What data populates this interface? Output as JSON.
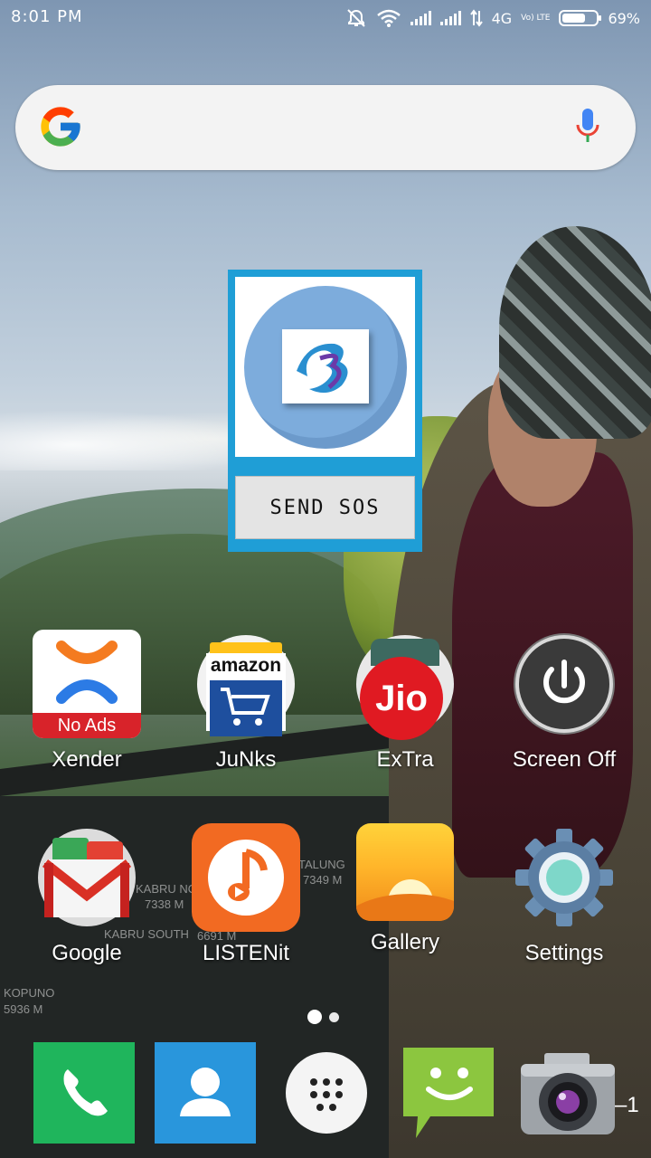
{
  "status_bar": {
    "time": "8:01 PM",
    "network_type": "4G",
    "volte_label": "Vo) LTE",
    "battery_percent_label": "69%",
    "battery_level": 0.69
  },
  "search": {
    "logo": "G",
    "mic_icon": "mic-icon"
  },
  "widget": {
    "logo_icon": "b-logo-icon",
    "sos_label": "SEND SOS"
  },
  "apps_row1": [
    {
      "label": "Xender",
      "badge": "No Ads",
      "icon": "xender-icon"
    },
    {
      "label": "JuNks",
      "icon_text": "amazon",
      "icon": "amazon-icon"
    },
    {
      "label": "ExTra",
      "icon_text": "Jio",
      "icon": "jio-icon"
    },
    {
      "label": "Screen Off",
      "icon": "power-icon"
    }
  ],
  "apps_row2": [
    {
      "label": "Google",
      "icon": "gmail-icon"
    },
    {
      "label": "LISTENit",
      "icon": "music-note-icon"
    },
    {
      "label": "Gallery",
      "icon": "gallery-icon"
    },
    {
      "label": "Settings",
      "icon": "gear-icon"
    }
  ],
  "wallpaper_labels": {
    "kabru_north": "KABRU NORTH",
    "kabru_north_height": "7338 M",
    "kabru_south": "KABRU SOUTH",
    "kabru_south_height": "6691 M",
    "talung": "TALUNG",
    "talung_height": "7349 M",
    "kopuno": "KOPUNO",
    "kopuno_height": "5936 M"
  },
  "dock": [
    {
      "icon": "phone-icon"
    },
    {
      "icon": "contacts-icon"
    },
    {
      "icon": "app-drawer-icon"
    },
    {
      "icon": "messaging-icon"
    },
    {
      "icon": "camera-icon"
    }
  ],
  "page_indicator": "1",
  "colors": {
    "widget_border": "#1f9ed6",
    "xender_red": "#d8232a",
    "jio_red": "#e01a22",
    "listen_orange": "#f26a22",
    "phone_green": "#1fb55c",
    "contacts_blue": "#2996dc"
  }
}
